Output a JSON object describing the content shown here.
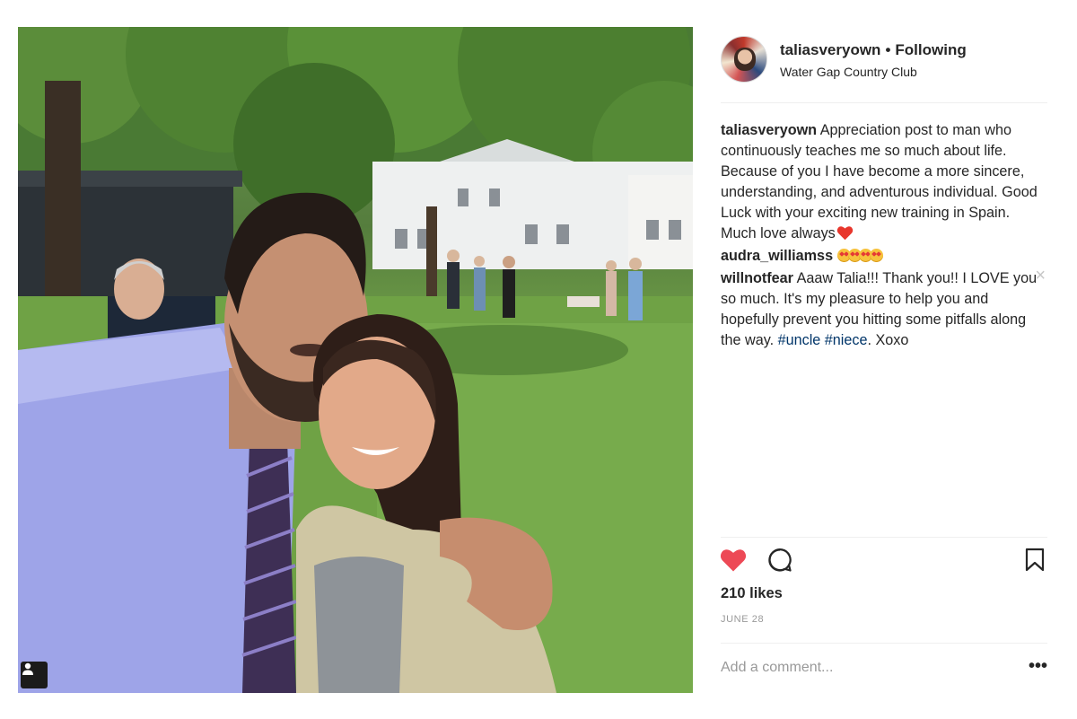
{
  "post": {
    "username": "taliasveryown",
    "separator": "•",
    "follow_status": "Following",
    "location": "Water Gap Country Club",
    "caption": {
      "author": "taliasveryown",
      "text": "Appreciation post to man who continuously teaches me so much about life. Because of you I have become a more sincere, understanding, and adventurous individual. Good Luck with your exciting new training in Spain. Much love always",
      "emoji": "red-heart-emoji"
    },
    "comments": [
      {
        "author": "audra_williamss",
        "emoji": "heart-eyes-emoji x4"
      },
      {
        "author": "willnotfear",
        "text_before": "Aaaw Talia!!! Thank you!! I LOVE you so much. It's my pleasure to help you and hopefully prevent you hitting some pitfalls along the way.",
        "tag1": "#uncle",
        "tag2": "#niece",
        "text_after": ". Xoxo",
        "close_symbol": "×"
      }
    ],
    "likes": "210 likes",
    "date": "JUNE 28",
    "add_comment_placeholder": "Add a comment...",
    "more_symbol": "•••"
  },
  "icons": {
    "like": "heart-icon (filled red)",
    "comment": "comment-bubble-icon",
    "save": "bookmark-icon",
    "tagged_people": "user-tag-icon"
  },
  "colors": {
    "like_red": "#ed4956",
    "hashtag_blue": "#003569",
    "muted_text": "#999999",
    "divider": "#efefef"
  }
}
